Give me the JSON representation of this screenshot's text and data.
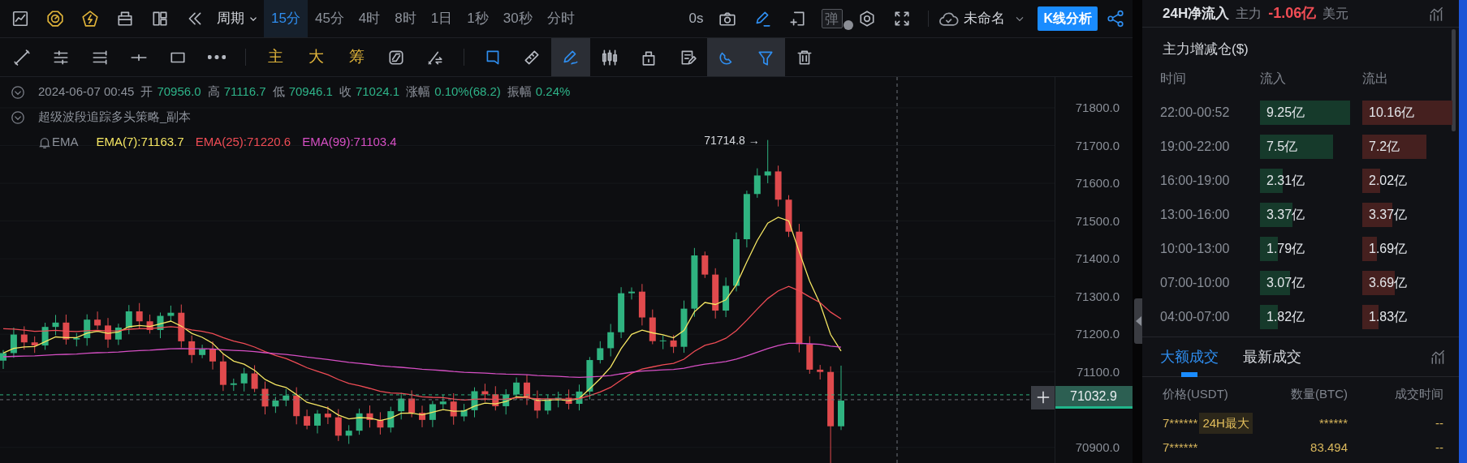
{
  "toolbar": {
    "period_label": "周期",
    "intervals": [
      {
        "label": "15分",
        "selected": true
      },
      {
        "label": "45分",
        "selected": false
      },
      {
        "label": "4时",
        "selected": false
      },
      {
        "label": "8时",
        "selected": false
      },
      {
        "label": "1日",
        "selected": false
      },
      {
        "label": "1秒",
        "selected": false
      },
      {
        "label": "30秒",
        "selected": false
      },
      {
        "label": "分时",
        "selected": false
      }
    ],
    "timer": "0s",
    "popup_toggle": "弹",
    "layout_name": "未命名",
    "analysis_button": "K线分析"
  },
  "drawing_toolbar": {
    "tools": [
      {
        "active": false
      },
      {
        "active": false
      },
      {
        "active": false
      },
      {
        "active": false
      },
      {
        "active": false
      },
      {
        "active": false
      }
    ],
    "shortcuts": [
      "主",
      "大",
      "筹"
    ],
    "shortcut_tools": [
      {
        "active": false
      },
      {
        "active": false
      }
    ],
    "object_tools": [
      {
        "active": false
      },
      {
        "active": false
      },
      {
        "active": true
      },
      {
        "active": false
      },
      {
        "active": false
      },
      {
        "active": false
      },
      {
        "active": true
      },
      {
        "active": true
      },
      {
        "active": false
      }
    ]
  },
  "legend": {
    "datetime": "2024-06-07 00:45",
    "quote": [
      {
        "label": "开",
        "value": "70956.0"
      },
      {
        "label": "高",
        "value": "71116.7"
      },
      {
        "label": "低",
        "value": "70946.1"
      },
      {
        "label": "收",
        "value": "71024.1"
      },
      {
        "label": "涨幅",
        "value": "0.10%(68.2)"
      },
      {
        "label": "振幅",
        "value": "0.24%"
      }
    ],
    "strategy": "超级波段追踪多头策略_副本",
    "indicator": "EMA",
    "ema": [
      {
        "text": "EMA(7):71163.7",
        "color": "#f5e663"
      },
      {
        "text": "EMA(25):71220.6",
        "color": "#ef4c55"
      },
      {
        "text": "EMA(99):71103.4",
        "color": "#d64fc4"
      }
    ]
  },
  "chart": {
    "peak_label": "71714.8 →",
    "price_ticks": [
      "71800.0",
      "71700.0",
      "71600.0",
      "71500.0",
      "71400.0",
      "71300.0",
      "71200.0",
      "71100.0",
      "70900.0"
    ],
    "last_price": "71032.9"
  },
  "net_flow": {
    "title": "24H净流入",
    "subtitle": "主力",
    "amount": "-1.06亿",
    "unit": "美元"
  },
  "position_change": {
    "title": "主力增减仓($)",
    "columns": [
      "时间",
      "流入",
      "流出"
    ],
    "rows": [
      {
        "time": "22:00-00:52",
        "inflow": "9.25亿",
        "outflow": "10.16亿"
      },
      {
        "time": "19:00-22:00",
        "inflow": "7.5亿",
        "outflow": "7.2亿"
      },
      {
        "time": "16:00-19:00",
        "inflow": "2.31亿",
        "outflow": "2.02亿"
      },
      {
        "time": "13:00-16:00",
        "inflow": "3.37亿",
        "outflow": "3.37亿"
      },
      {
        "time": "10:00-13:00",
        "inflow": "1.79亿",
        "outflow": "1.69亿"
      },
      {
        "time": "07:00-10:00",
        "inflow": "3.07亿",
        "outflow": "3.69亿"
      },
      {
        "time": "04:00-07:00",
        "inflow": "1.82亿",
        "outflow": "1.83亿"
      }
    ]
  },
  "trades": {
    "tabs": [
      {
        "label": "大额成交",
        "selected": true
      },
      {
        "label": "最新成交",
        "selected": false
      }
    ],
    "columns": [
      "价格(USDT)",
      "数量(BTC)",
      "成交时间"
    ],
    "rows": [
      {
        "price": "7******",
        "badge": "24H最大",
        "amount": "******",
        "time": "--"
      },
      {
        "price": "7******",
        "amount": "83.494",
        "time": "--"
      }
    ]
  }
}
